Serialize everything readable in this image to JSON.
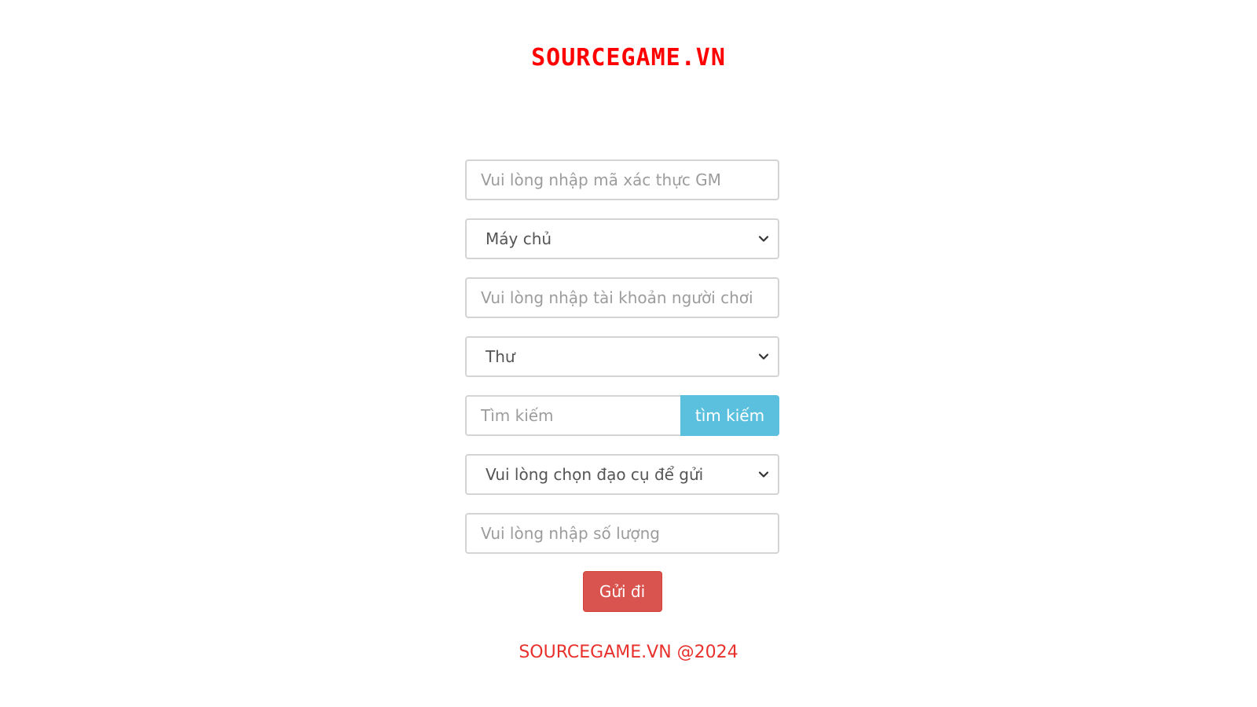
{
  "header": {
    "logo_text": "SOURCEGAME.VN"
  },
  "form": {
    "gm_code": {
      "placeholder": "Vui lòng nhập mã xác thực GM",
      "value": ""
    },
    "server_select": {
      "selected": "Máy chủ",
      "icon": "chevron-down-icon"
    },
    "player_account": {
      "placeholder": "Vui lòng nhập tài khoản người chơi",
      "value": ""
    },
    "type_select": {
      "selected": "Thư",
      "icon": "chevron-down-icon"
    },
    "search": {
      "placeholder": "Tìm kiếm",
      "value": "",
      "button_label": "tìm kiếm"
    },
    "item_select": {
      "selected": "Vui lòng chọn đạo cụ để gửi",
      "icon": "chevron-down-icon"
    },
    "quantity": {
      "placeholder": "Vui lòng nhập số lượng",
      "value": ""
    },
    "submit_label": "Gửi đi"
  },
  "footer": {
    "text": "SOURCEGAME.VN @2024"
  },
  "colors": {
    "brand_red": "#ff0000",
    "search_button": "#5bc0de",
    "submit_button": "#d9534f",
    "border": "#d4d4d4"
  }
}
